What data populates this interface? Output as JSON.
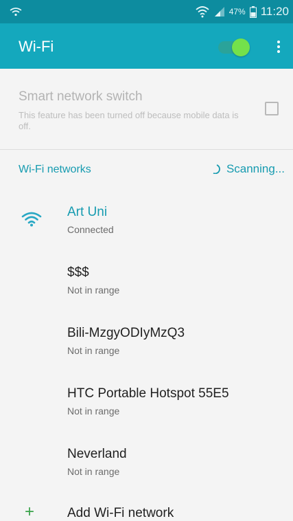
{
  "status_bar": {
    "battery_percent": "47%",
    "time": "11:20",
    "icons": [
      "wifi-calling-icon",
      "wifi-signal-icon",
      "cell-signal-icon",
      "battery-icon"
    ]
  },
  "app_bar": {
    "title": "Wi-Fi",
    "wifi_enabled": true,
    "accent_color": "#14a8bd"
  },
  "smart_network": {
    "label": "Smart network switch",
    "description": "This feature has been turned off because mobile data is off.",
    "checked": false
  },
  "networks_section": {
    "header": "Wi-Fi networks",
    "scanning_label": "Scanning..."
  },
  "networks": [
    {
      "name": "Art Uni",
      "status": "Connected",
      "connected": true
    },
    {
      "name": "$$$",
      "status": "Not in range",
      "connected": false
    },
    {
      "name": "Bili-MzgyODIyMzQ3",
      "status": "Not in range",
      "connected": false
    },
    {
      "name": "HTC Portable Hotspot 55E5",
      "status": "Not in range",
      "connected": false
    },
    {
      "name": "Neverland",
      "status": "Not in range",
      "connected": false
    }
  ],
  "add_network": {
    "label": "Add Wi-Fi network",
    "icon": "plus-icon"
  }
}
